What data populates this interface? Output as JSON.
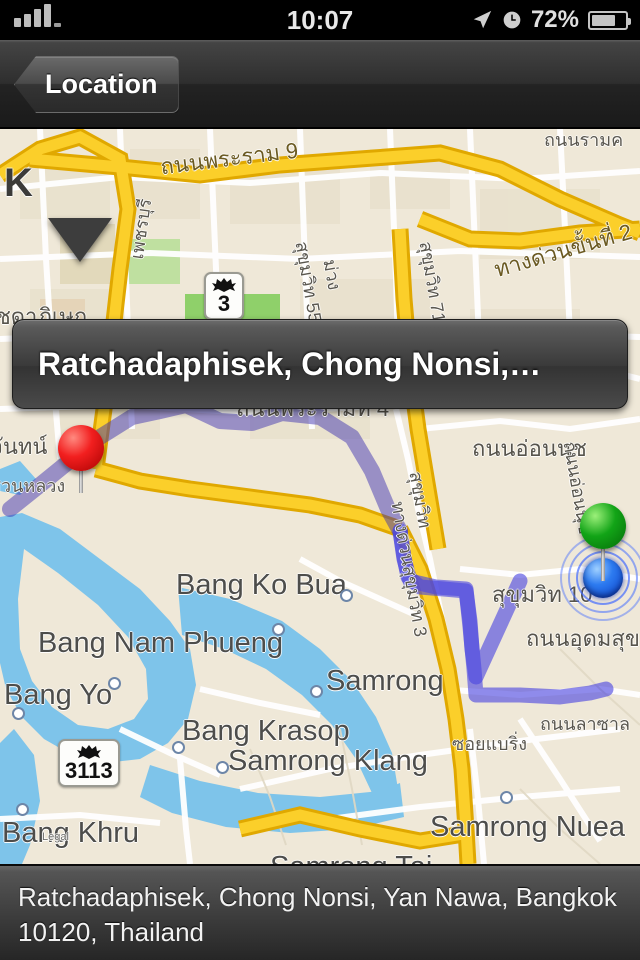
{
  "status_bar": {
    "signal_label": "signal-bars",
    "time": "10:07",
    "location_icon": "location-arrow-icon",
    "alarm_icon": "alarm-clock-icon",
    "battery_percent": "72%",
    "battery_level": 72
  },
  "nav_bar": {
    "back_label": "Location"
  },
  "callout": {
    "title": "Ratchadaphisek, Chong Nonsi,…"
  },
  "bottom_bar": {
    "address_line1": "Ratchadaphisek, Chong Nonsi, Yan Nawa, Bangkok",
    "address_line2": "10120, Thailand"
  },
  "map": {
    "start_pin": "red-start-pin",
    "end_pin": "green-destination-pin",
    "user_location": "blue-current-location-dot",
    "shields": [
      {
        "number": "3",
        "emblem": "garuda-emblem"
      },
      {
        "number": "3113",
        "emblem": "garuda-emblem"
      }
    ],
    "labels_en": [
      "K",
      "Bang Ko Bua",
      "Bang Nam Phueng",
      "Bang Yo",
      "Samrong",
      "Bang Krasop",
      "Samrong Klang",
      "Bang Khru",
      "Samrong Nuea",
      "Samrong Tai",
      "Samrong Nuea"
    ],
    "labels_th": [
      "ถนนพระราม 9",
      "ถนนรามค",
      "ทางด่วนขั้นที่ 2",
      "ถนนพระรามที่ 4",
      "ถนนอ่อนนุช",
      "ถนนอุดมสุข",
      "สุขุมวิท 10",
      "สุขุมวิท",
      "จันทน์",
      "รัชดาภิเษก",
      "เพชรบุรี",
      "สุขุมวิท 55",
      "สุขุมวิท 71",
      "ทางด่วนสุขุมวิท 3",
      "ซอยแบริ่ง",
      "ถนนลาซาล",
      "สวนหลวง",
      "ม่วง"
    ],
    "legal": "Legal",
    "colors": {
      "land": "#efe8d8",
      "water": "#7ec4ea",
      "highway": "#fbcf2a",
      "road": "#ffffff",
      "route": "#5050c8",
      "park": "#bfe0a0"
    }
  }
}
